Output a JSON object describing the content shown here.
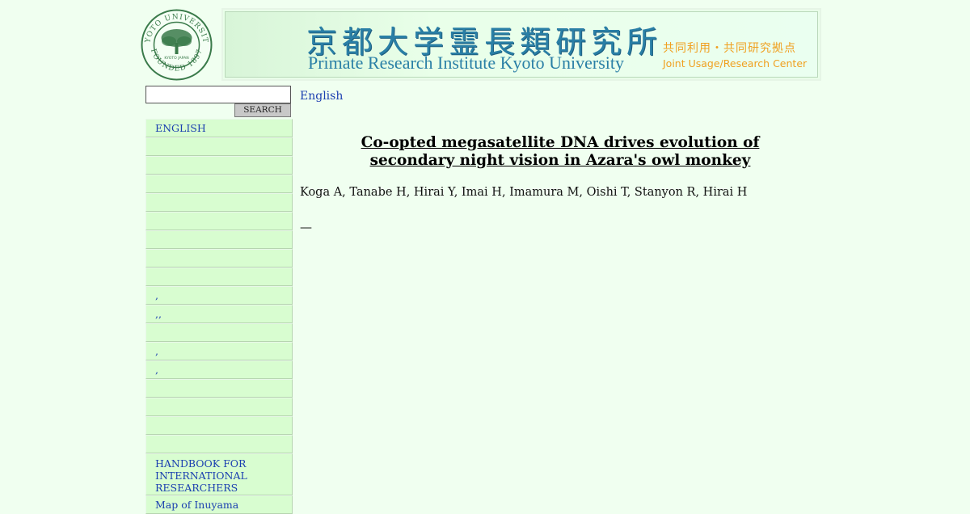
{
  "header": {
    "logo": {
      "name": "kyoto-university-seal",
      "ring_top": "KYOTO UNIVERSITY",
      "ring_bottom": "FOUNDED 1897",
      "center_text": "KYOTO JAPAN",
      "color": "#3a7a4a"
    },
    "banner": {
      "jp_title": "京都大学霊長類研究所",
      "en_title": "Primate Research Institute Kyoto University",
      "jp_subtitle": "共同利用・共同研究拠点",
      "en_subtitle": "Joint Usage/Research Center",
      "title_color": "#2a7fa6",
      "subtitle_color": "#f0a020"
    }
  },
  "search": {
    "value": "",
    "button_label": "SEARCH"
  },
  "nav": {
    "items": [
      {
        "label": "ENGLISH"
      },
      {
        "label": ""
      },
      {
        "label": ""
      },
      {
        "label": ""
      },
      {
        "label": ""
      },
      {
        "label": ""
      },
      {
        "label": ""
      },
      {
        "label": ""
      },
      {
        "label": ""
      },
      {
        "label": ","
      },
      {
        "label": ",,"
      },
      {
        "label": ""
      },
      {
        "label": ","
      },
      {
        "label": ","
      },
      {
        "label": ""
      },
      {
        "label": ""
      },
      {
        "label": ""
      },
      {
        "label": ""
      },
      {
        "label": "HANDBOOK FOR INTERNATIONAL RESEARCHERS"
      },
      {
        "label": "Map of Inuyama"
      }
    ]
  },
  "main": {
    "lang_link": "English",
    "title": "Co-opted megasatellite DNA drives evolution of secondary night vision in Azara's owl monkey",
    "authors": "Koga A, Tanabe H, Hirai Y, Imai H, Imamura M, Oishi T, Stanyon R, Hirai H",
    "separator": "—"
  },
  "colors": {
    "page_background": "#f0fff0",
    "nav_item_background": "#d8fdd0",
    "link": "#1a3fb0"
  }
}
